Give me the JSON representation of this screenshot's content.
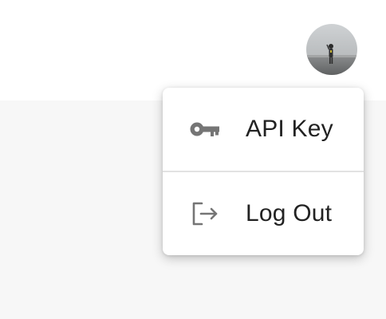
{
  "colors": {
    "header_bg": "#ffffff",
    "page_bg": "#f7f7f7",
    "icon": "#757575",
    "text": "#222222",
    "divider": "#e2e2e2"
  },
  "header": {
    "avatar_icon": "user-avatar-photo"
  },
  "menu": {
    "items": [
      {
        "label": "API Key",
        "icon": "key-icon"
      },
      {
        "label": "Log Out",
        "icon": "logout-icon"
      }
    ]
  }
}
